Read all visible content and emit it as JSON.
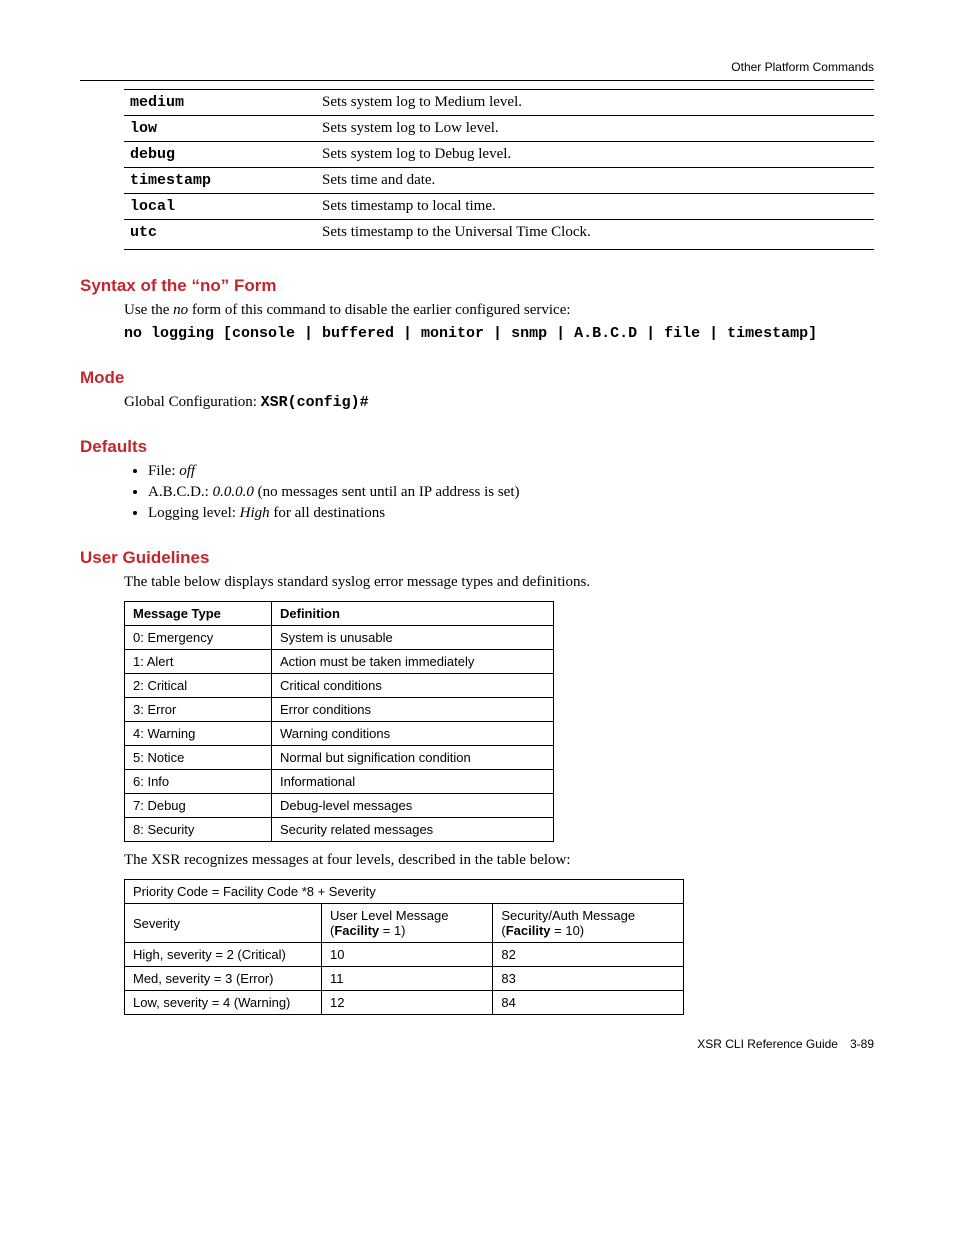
{
  "header_right": "Other Platform Commands",
  "param_rows": [
    {
      "k": "medium",
      "d": "Sets system log to Medium level."
    },
    {
      "k": "low",
      "d": "Sets system log to Low level."
    },
    {
      "k": "debug",
      "d": "Sets system log to Debug level."
    },
    {
      "k": "timestamp",
      "d": "Sets time and date."
    },
    {
      "k": "local",
      "d": "Sets timestamp to local time."
    },
    {
      "k": "utc",
      "d": "Sets timestamp to the Universal Time Clock."
    }
  ],
  "syntax": {
    "title": "Syntax of the “no” Form",
    "intro_before": "Use the ",
    "intro_ital": "no",
    "intro_after": " form of this command to disable the earlier configured service:",
    "code": "no logging [console | buffered | monitor | snmp | A.B.C.D | file | timestamp]"
  },
  "mode": {
    "title": "Mode",
    "before": "Global Configuration: ",
    "code": "XSR(config)#"
  },
  "defaults": {
    "title": "Defaults",
    "items": [
      {
        "pre": "File: ",
        "it": "off",
        "post": ""
      },
      {
        "pre": "A.B.C.D.: ",
        "it": "0.0.0.0",
        "post": " (no messages sent until an IP address is set)"
      },
      {
        "pre": "Logging level: ",
        "it": "High",
        "post": " for all destinations"
      }
    ]
  },
  "ug": {
    "title": "User Guidelines",
    "intro": "The table below displays standard syslog error message types and definitions.",
    "cols": {
      "c1": "Message Type",
      "c2": "Definition"
    },
    "rows": [
      {
        "a": "0: Emergency",
        "b": "System is unusable"
      },
      {
        "a": "1: Alert",
        "b": "Action must be taken immediately"
      },
      {
        "a": "2: Critical",
        "b": "Critical conditions"
      },
      {
        "a": "3: Error",
        "b": "Error conditions"
      },
      {
        "a": "4: Warning",
        "b": "Warning conditions"
      },
      {
        "a": "5: Notice",
        "b": "Normal but signification condition"
      },
      {
        "a": "6: Info",
        "b": "Informational"
      },
      {
        "a": "7: Debug",
        "b": "Debug-level messages"
      },
      {
        "a": "8: Security",
        "b": "Security related messages"
      }
    ],
    "mid": "The XSR recognizes messages at four levels, described in the table below:"
  },
  "prio": {
    "caption": "Priority Code = Facility Code *8 + Severity",
    "h1": "Severity",
    "h2a": "User Level Message",
    "h2b": "Facility",
    "h2c": " = 1)",
    "h3a": "Security/Auth Message",
    "h3b": "Facility",
    "h3c": " = 10)",
    "rows": [
      {
        "a": "High, severity = 2 (Critical)",
        "b": "10",
        "c": "82"
      },
      {
        "a": "Med, severity = 3 (Error)",
        "b": "11",
        "c": "83"
      },
      {
        "a": "Low, severity = 4 (Warning)",
        "b": "12",
        "c": "84"
      }
    ]
  },
  "footer": {
    "a": "XSR CLI Reference Guide",
    "b": "3-89",
    "sep": " "
  }
}
